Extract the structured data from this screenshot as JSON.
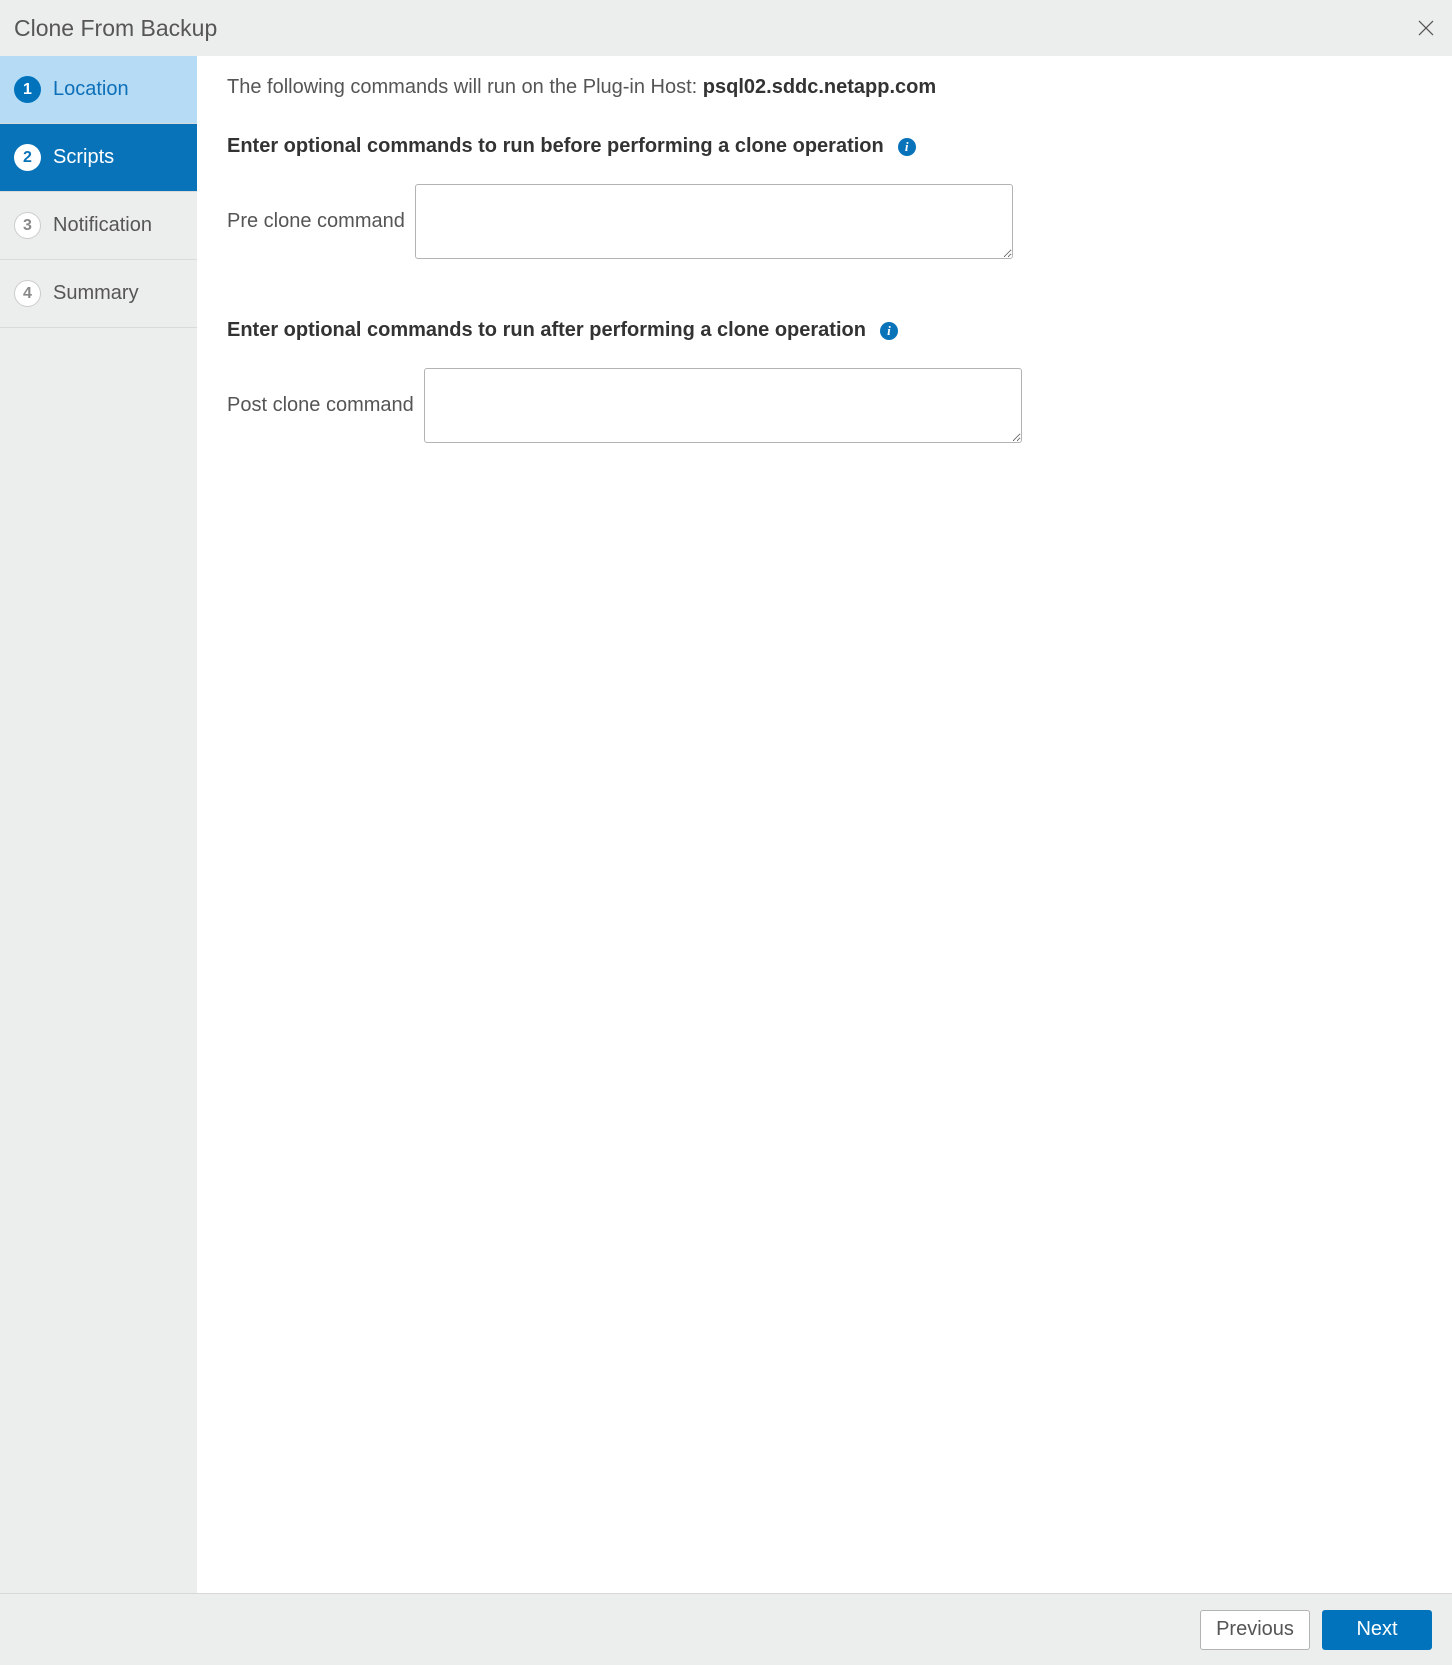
{
  "header": {
    "title": "Clone From Backup"
  },
  "steps": [
    {
      "num": "1",
      "label": "Location",
      "state": "completed"
    },
    {
      "num": "2",
      "label": "Scripts",
      "state": "active"
    },
    {
      "num": "3",
      "label": "Notification",
      "state": "upcoming"
    },
    {
      "num": "4",
      "label": "Summary",
      "state": "upcoming"
    }
  ],
  "content": {
    "host_prefix": "The following commands will run on the Plug-in Host: ",
    "host_name": "psql02.sddc.netapp.com",
    "pre_heading": "Enter optional commands to run before performing a clone operation",
    "pre_label": "Pre clone command",
    "pre_value": "",
    "post_heading": "Enter optional commands to run after performing a clone operation",
    "post_label": "Post clone command",
    "post_value": "",
    "info_glyph": "i"
  },
  "footer": {
    "previous": "Previous",
    "next": "Next"
  }
}
